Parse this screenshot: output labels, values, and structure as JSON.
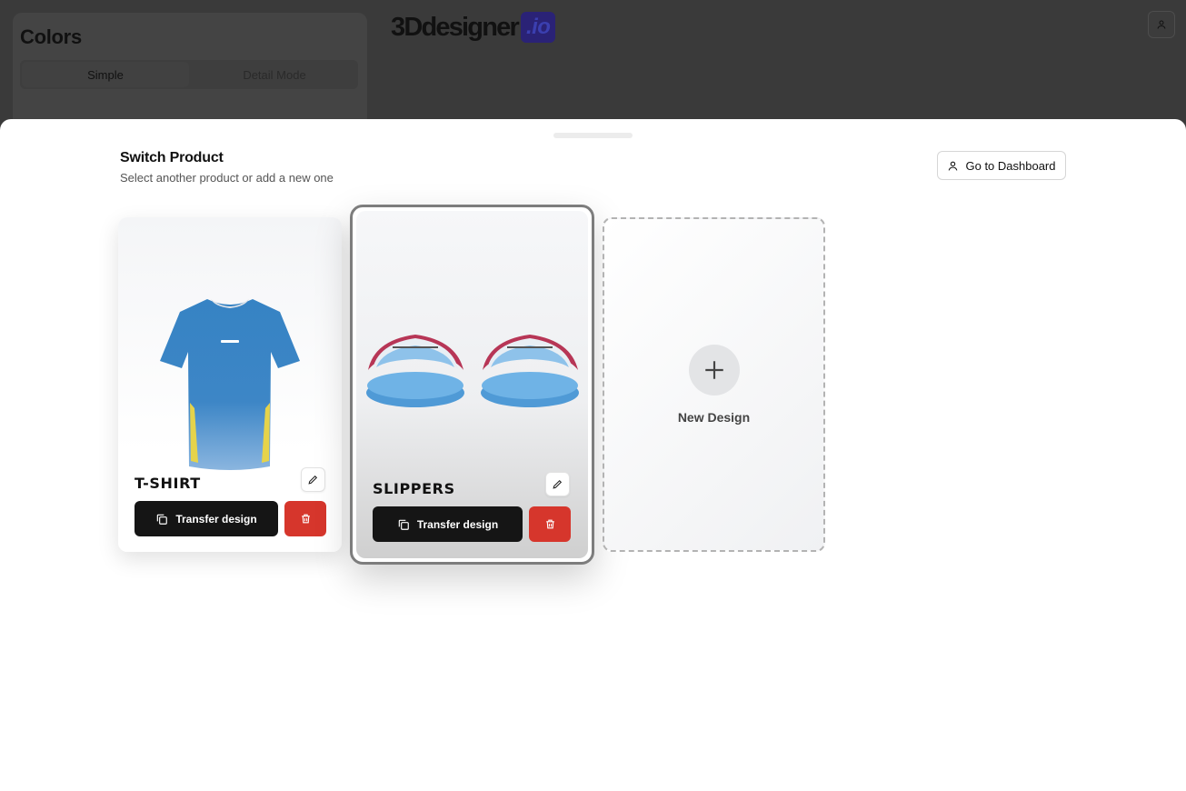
{
  "background": {
    "colors_panel": {
      "title": "Colors",
      "tabs": [
        "Simple",
        "Detail Mode"
      ]
    },
    "logo": {
      "main": "3Ddesigner",
      "badge": ".io"
    }
  },
  "sheet": {
    "title": "Switch Product",
    "subtitle": "Select another product or add a new one",
    "dashboard_button": "Go to Dashboard",
    "products": [
      {
        "name": "T-SHIRT",
        "transfer_label": "Transfer design",
        "selected": false
      },
      {
        "name": "SLIPPERS",
        "transfer_label": "Transfer design",
        "selected": true
      }
    ],
    "new_design_label": "New Design"
  },
  "colors": {
    "primary_dark": "#151515",
    "danger": "#d6362c",
    "product_blue": "#3d86c6",
    "brand_badge": "#2a2276"
  }
}
